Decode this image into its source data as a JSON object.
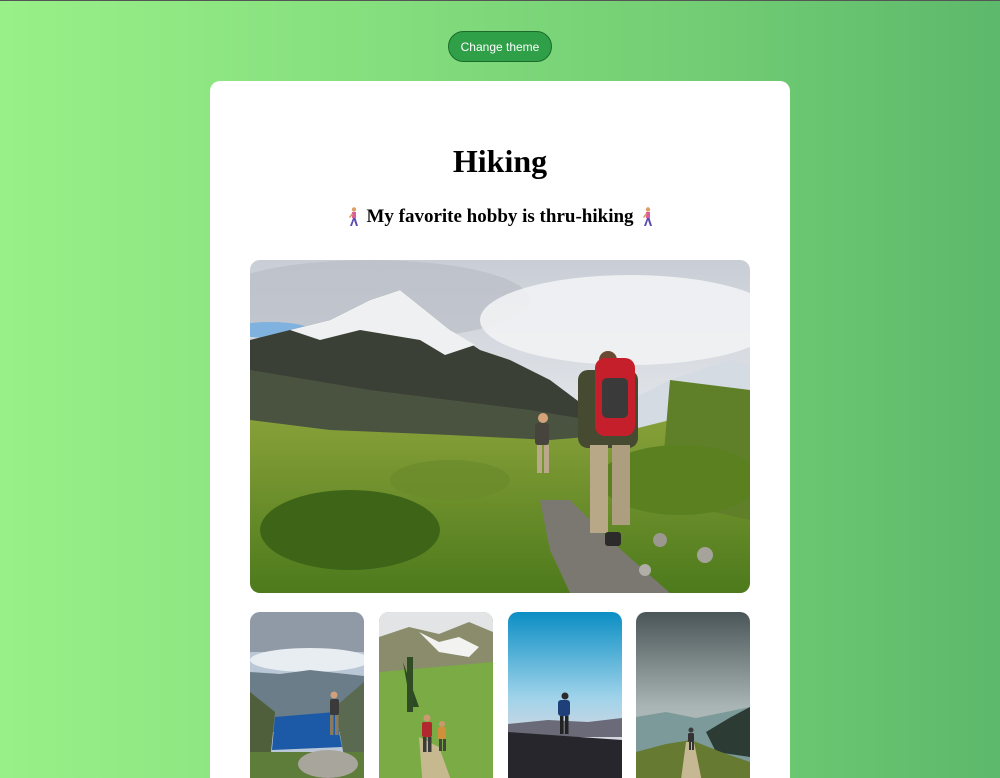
{
  "toolbar": {
    "change_theme_label": "Change theme"
  },
  "card": {
    "title": "Hiking",
    "subtitle": "My favorite hobby is thru-hiking"
  },
  "images": {
    "hero": "hiking-hero-photo",
    "thumbnails": [
      "lake-view-hiker-photo",
      "meadow-hikers-photo",
      "sunset-hiker-photo",
      "ridge-trail-hiker-photo"
    ]
  },
  "icons": {
    "subtitle_left": "person-walking-icon",
    "subtitle_right": "person-walking-icon"
  },
  "colors": {
    "background_start": "#98f088",
    "background_end": "#5db96b",
    "button": "#2f9f48",
    "card": "#ffffff"
  }
}
